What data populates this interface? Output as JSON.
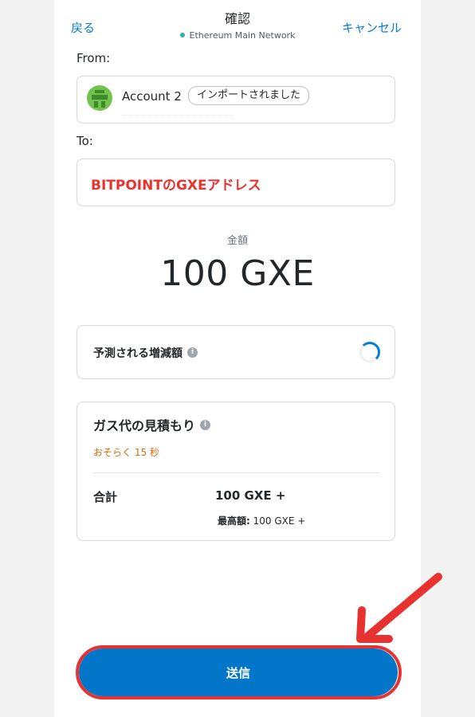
{
  "header": {
    "back_label": "戻る",
    "title": "確認",
    "network": "Ethereum Main Network",
    "cancel_label": "キャンセル"
  },
  "from": {
    "label": "From:",
    "account_name": "Account 2",
    "account_badge": "インポートされました"
  },
  "to": {
    "label": "To:",
    "address_text": "BITPOINTのGXEアドレス"
  },
  "amount": {
    "label": "金額",
    "value": "100 GXE"
  },
  "balance_change": {
    "title": "予測される増減額",
    "info_icon": "i"
  },
  "gas": {
    "title": "ガス代の見積もり",
    "info_icon": "i",
    "time_estimate": "おそらく 15 秒",
    "total_label": "合計",
    "total_value": "100 GXE +",
    "max_label": "最高額:",
    "max_value": "100 GXE +"
  },
  "actions": {
    "send_label": "送信"
  },
  "colors": {
    "accent": "#037dd6",
    "send_button": "#0376c9",
    "highlight": "#e8322f",
    "network_dot": "#29b6af",
    "time_estimate": "#d46c0b"
  }
}
